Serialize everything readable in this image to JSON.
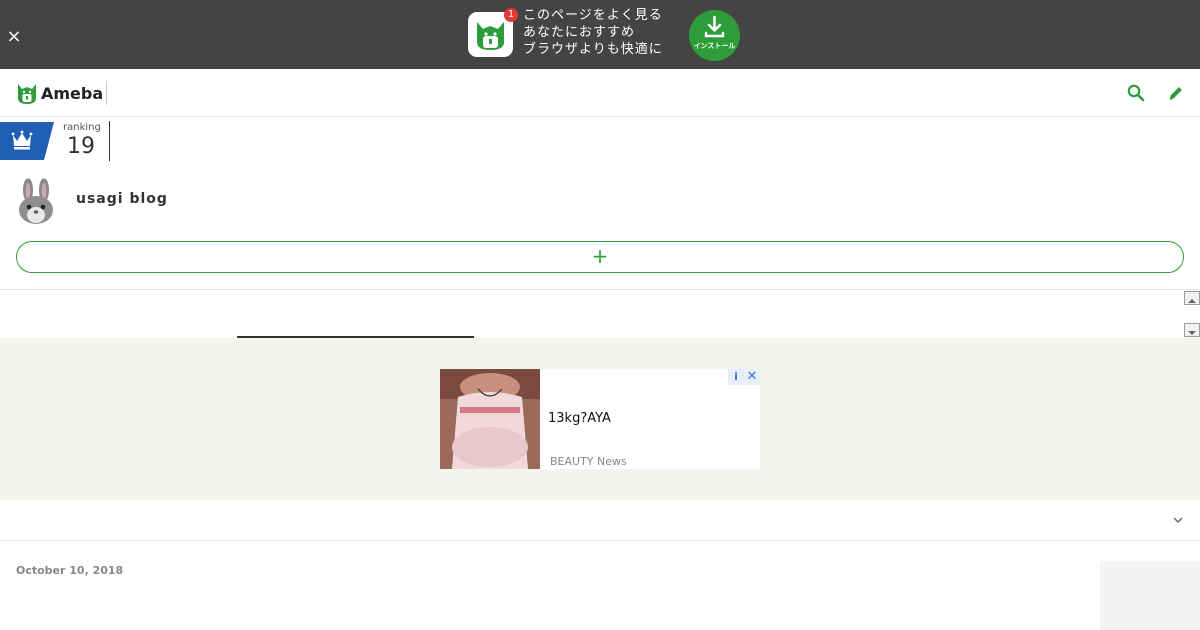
{
  "banner": {
    "line1": "このページをよく見る",
    "line2": "あなたにおすすめ",
    "line3": "ブラウザよりも快適に",
    "badge_count": "1",
    "install_label": "インストール",
    "close_glyph": "×"
  },
  "header": {
    "logo_text": "Ameba"
  },
  "ranking": {
    "label": "ranking",
    "number": "19"
  },
  "profile": {
    "blog_title": "usagi blog",
    "follow_glyph": "+"
  },
  "ad": {
    "title": "13kg?AYA",
    "source": "BEAUTY News",
    "info_glyph": "i",
    "close_glyph": "✕"
  },
  "post": {
    "date": "October 10, 2018"
  },
  "colors": {
    "accent": "#2d9d3a",
    "banner_bg": "#444444",
    "rank_blue": "#1f5fb4"
  }
}
